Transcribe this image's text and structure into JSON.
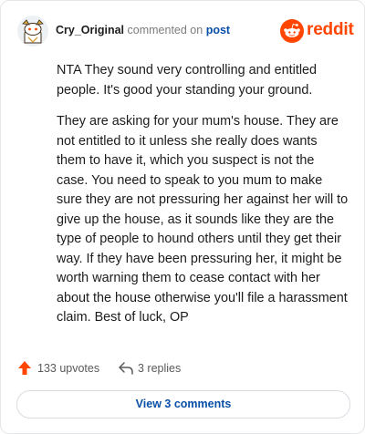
{
  "header": {
    "username": "Cry_Original",
    "verb": "commented on",
    "post_link": "post",
    "brand": "reddit"
  },
  "comment": {
    "paragraphs": [
      "NTA They sound very controlling and entitled people. It's good your standing your ground.",
      "They are asking for your mum's house. They are not entitled to it unless she really does wants them to have it, which you suspect is not the case. You need to speak to you mum to make sure they are not pressuring her against her will to give up the house, as it sounds like they are the type of people to hound others until they get their way. If they have been pressuring her, it might be worth warning them to cease contact with her about the house otherwise you'll file a harassment claim. Best of luck, OP"
    ]
  },
  "actions": {
    "upvotes": "133 upvotes",
    "replies": "3 replies",
    "view_comments": "View 3 comments"
  },
  "icons": {
    "avatar": "snoo-avatar-icon",
    "brand": "reddit-logo-icon",
    "upvote": "upvote-arrow-icon",
    "reply": "reply-arrow-icon"
  },
  "colors": {
    "brand": "#ff4500",
    "link": "#0a4fa8",
    "upvote": "#ff4500"
  }
}
